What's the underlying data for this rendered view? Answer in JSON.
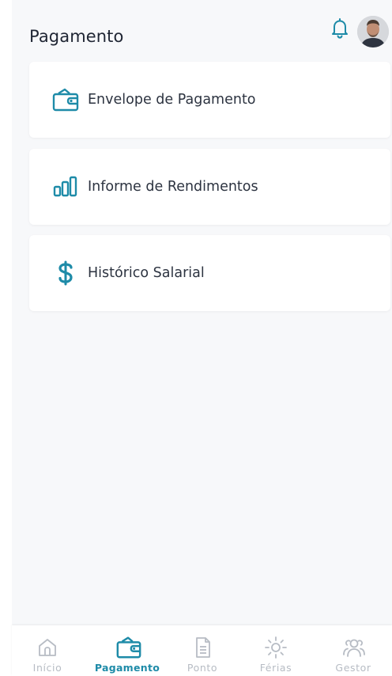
{
  "header": {
    "title": "Pagamento"
  },
  "menu": {
    "items": [
      {
        "label": "Envelope de Pagamento",
        "icon": "wallet-icon"
      },
      {
        "label": "Informe de Rendimentos",
        "icon": "bar-chart-icon"
      },
      {
        "label": "Histórico Salarial",
        "icon": "dollar-icon"
      }
    ]
  },
  "bottom_nav": {
    "items": [
      {
        "label": "Início",
        "icon": "home-icon",
        "active": false
      },
      {
        "label": "Pagamento",
        "icon": "wallet-icon",
        "active": true
      },
      {
        "label": "Ponto",
        "icon": "document-icon",
        "active": false
      },
      {
        "label": "Férias",
        "icon": "sun-icon",
        "active": false
      },
      {
        "label": "Gestor",
        "icon": "users-icon",
        "active": false
      }
    ]
  },
  "colors": {
    "accent": "#1e8ba8",
    "inactive": "#b7bcc4",
    "background": "#f7f8fa",
    "text": "#1f2533"
  }
}
